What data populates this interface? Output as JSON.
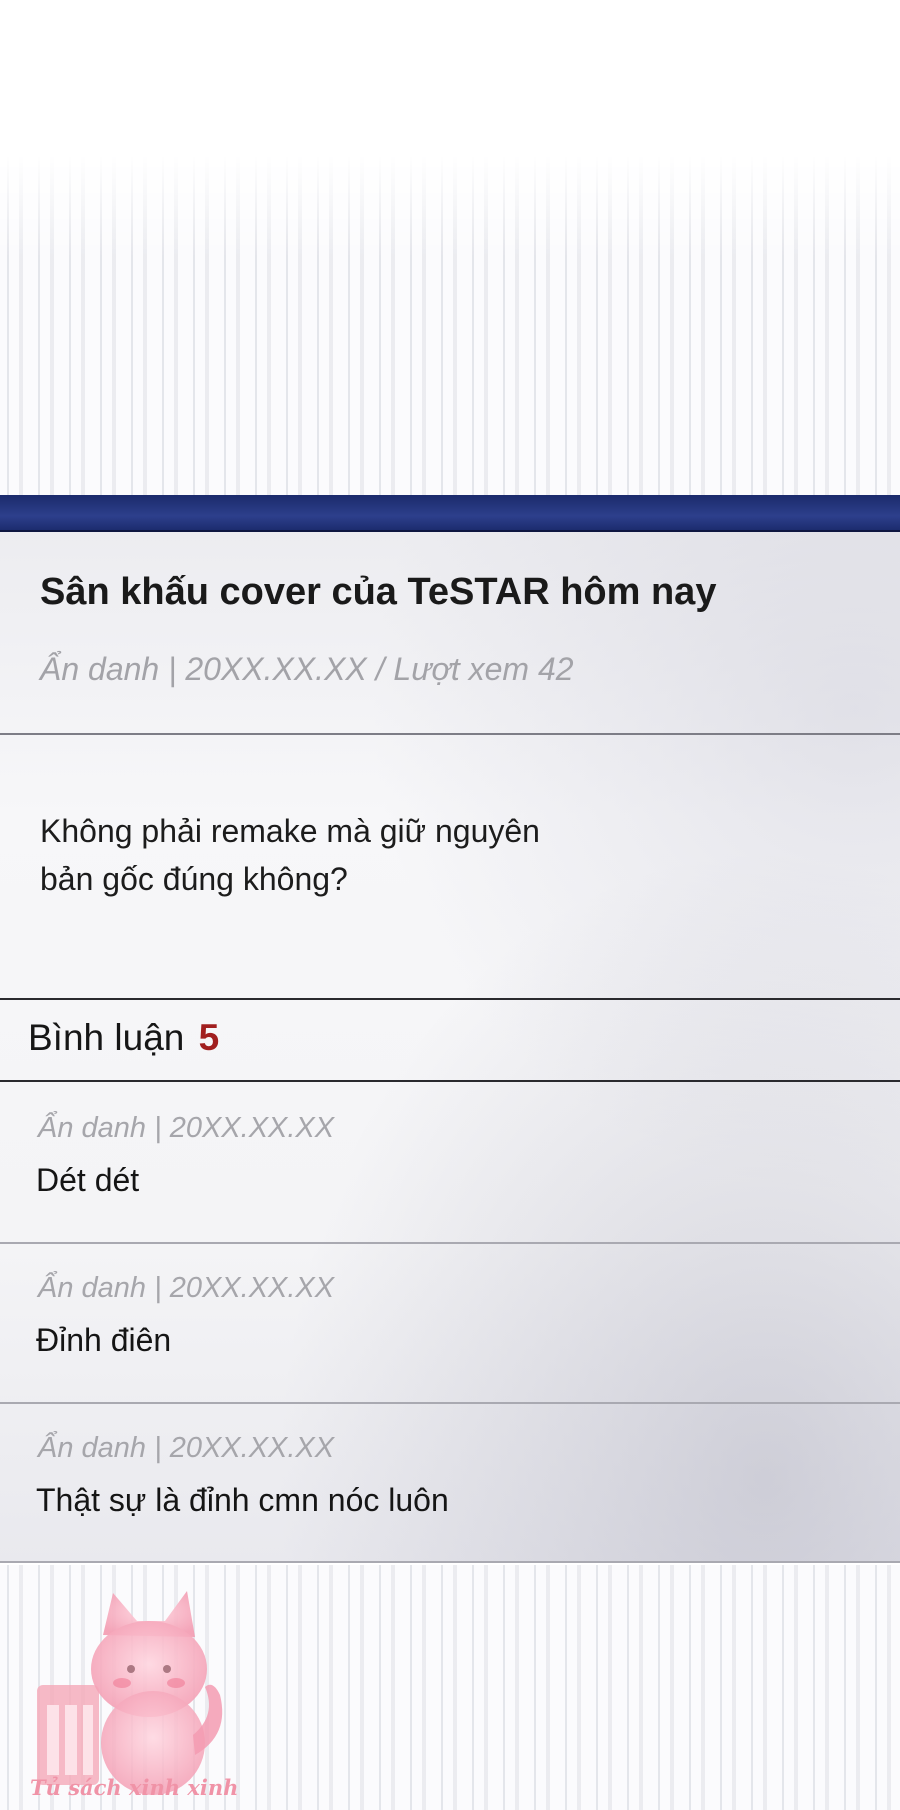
{
  "post": {
    "title": "Sân khấu cover của TeSTAR hôm nay",
    "meta": "Ẩn danh | 20XX.XX.XX  / Lượt xem 42",
    "body_line1": "Không phải remake mà giữ nguyên",
    "body_line2": "bản gốc đúng không?"
  },
  "comments_section": {
    "label": "Bình luận",
    "count": "5"
  },
  "comments": [
    {
      "meta": "Ẩn danh | 20XX.XX.XX",
      "text": "Dét dét"
    },
    {
      "meta": "Ẩn danh | 20XX.XX.XX",
      "text": "Đỉnh điên"
    },
    {
      "meta": "Ẩn danh | 20XX.XX.XX",
      "text": "Thật sự là đỉnh cmn nóc luôn"
    }
  ],
  "watermark": {
    "text": "Tủ sách xinh xinh",
    "icon": "cat-bookshelf-logo"
  },
  "colors": {
    "header_bar": "#22327a",
    "comment_count": "#a11f1f",
    "meta_text": "#a3a3a8"
  }
}
